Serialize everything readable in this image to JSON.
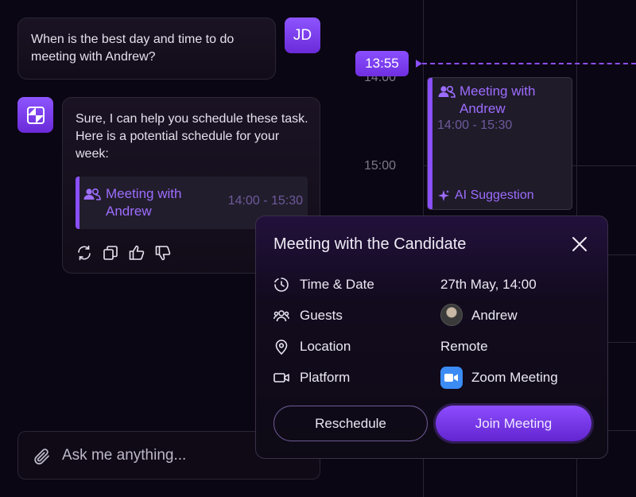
{
  "chat": {
    "user_initials": "JD",
    "user_message": "When is the best day and time to do meeting with Andrew?",
    "bot_message": "Sure, I can help you schedule these task. Here is a potential schedule for your week:",
    "suggested_event": {
      "title": "Meeting with Andrew",
      "time": "14:00 - 15:30"
    },
    "input_placeholder": "Ask me anything..."
  },
  "calendar": {
    "current_time": "13:55",
    "time_labels": [
      "14:00",
      "15:00"
    ],
    "event": {
      "title": "Meeting with Andrew",
      "time": "14:00 - 15:30",
      "tag": "AI Suggestion"
    }
  },
  "modal": {
    "title": "Meeting with the Candidate",
    "rows": [
      {
        "label": "Time & Date",
        "value": "27th May, 14:00"
      },
      {
        "label": "Guests",
        "value": "Andrew"
      },
      {
        "label": "Location",
        "value": "Remote"
      },
      {
        "label": "Platform",
        "value": "Zoom Meeting"
      }
    ],
    "reschedule_label": "Reschedule",
    "join_label": "Join Meeting"
  },
  "colors": {
    "accent": "#8a4fff",
    "background": "#0b0613",
    "zoom": "#3b8cf5"
  }
}
